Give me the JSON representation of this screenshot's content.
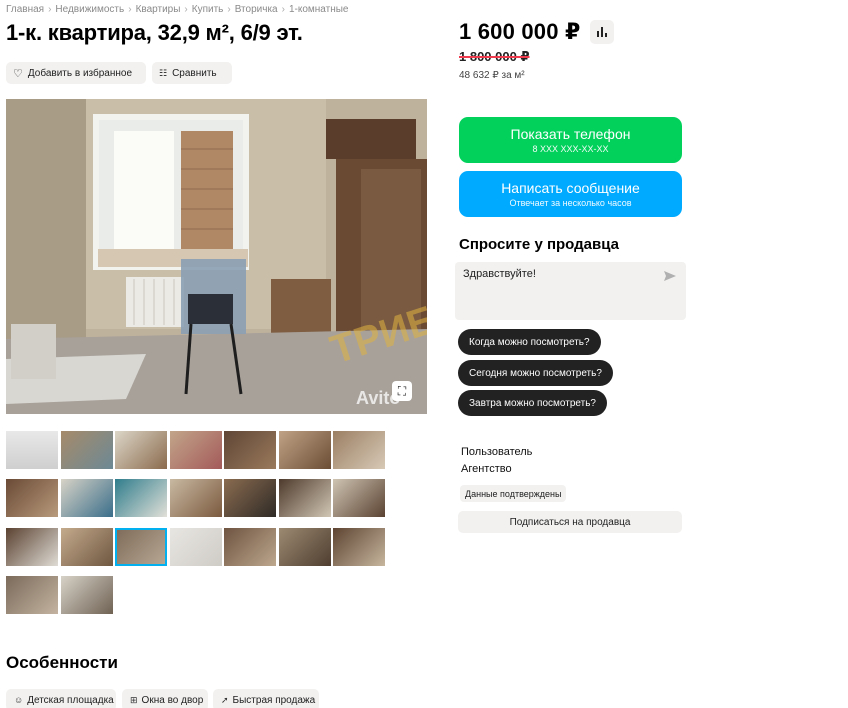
{
  "breadcrumbs": [
    "Главная",
    "Недвижимость",
    "Квартиры",
    "Купить",
    "Вторичка",
    "1-комнатные"
  ],
  "title": "1-к. квартира, 32,9 м², 6/9 эт.",
  "actions": {
    "favorite": "Добавить в избранное",
    "compare": "Сравнить"
  },
  "price": {
    "current": "1 600 000 ₽",
    "old": "1 800 000 ₽",
    "per_m2": "48 632 ₽ за м²"
  },
  "phone_button": {
    "label": "Показать телефон",
    "masked": "8 XXX XXX-XX-XX"
  },
  "message_button": {
    "label": "Написать сообщение",
    "sub": "Отвечает за несколько часов"
  },
  "ask": {
    "title": "Спросите у продавца",
    "input_value": "Здравствуйте!",
    "chips": [
      "Когда можно посмотреть?",
      "Сегодня можно посмотреть?",
      "Завтра можно посмотреть?"
    ]
  },
  "seller": {
    "name": "Пользователь",
    "type": "Агентство",
    "verified": "Данные подтверждены",
    "subscribe": "Подписаться на продавца"
  },
  "photo": {
    "watermark": "Avito",
    "overlay_watermark": "ТРИБУН"
  },
  "features": {
    "title": "Особенности",
    "items": [
      {
        "label": "Детская площадка",
        "icon": "playground-icon"
      },
      {
        "label": "Окна во двор",
        "icon": "window-icon"
      },
      {
        "label": "Быстрая продажа",
        "icon": "rocket-icon"
      }
    ]
  },
  "colors": {
    "green": "#02d15c",
    "blue": "#00aaff",
    "chip": "#222222",
    "strike": "#ef3b4d"
  }
}
